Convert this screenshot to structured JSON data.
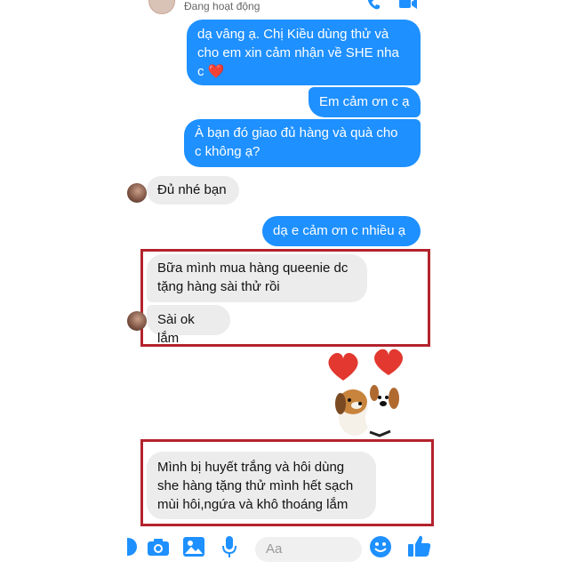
{
  "header": {
    "status": "Đang hoạt động"
  },
  "messages": [
    {
      "side": "out",
      "text": "dạ vâng ạ. Chị Kiều dùng thử và\ncho em xin cảm nhận về SHE nha\nc ❤️"
    },
    {
      "side": "out",
      "text": "Em cảm ơn c ạ"
    },
    {
      "side": "out",
      "text": "À bạn đó giao đủ hàng và quà cho\nc không ạ?"
    },
    {
      "side": "in",
      "text": "Đủ nhé bạn"
    },
    {
      "side": "out",
      "text": "dạ e cảm ơn c nhiều ạ"
    },
    {
      "side": "in",
      "text": "Bữa mình mua hàng queenie dc\ntặng hàng sài thử rồi"
    },
    {
      "side": "in",
      "text": "Sài ok lắm"
    },
    {
      "side": "in",
      "text": "Mình bị huyết trắng và hôi dùng\nshe hàng tặng thử mình hết sạch\nmùi hôi,ngứa và khô thoáng lắm"
    }
  ],
  "composer": {
    "placeholder": "Aa"
  },
  "icons": {
    "header": [
      "phone-icon",
      "video-call-icon"
    ],
    "bottom": [
      "more-icon",
      "camera-icon",
      "gallery-icon",
      "microphone-icon",
      "emoji-icon",
      "thumbs-up-icon"
    ]
  },
  "colors": {
    "outgoing_bubble": "#1e90ff",
    "incoming_bubble": "#ececec",
    "highlight_border": "#b3232d",
    "accent": "#1e90ff"
  }
}
